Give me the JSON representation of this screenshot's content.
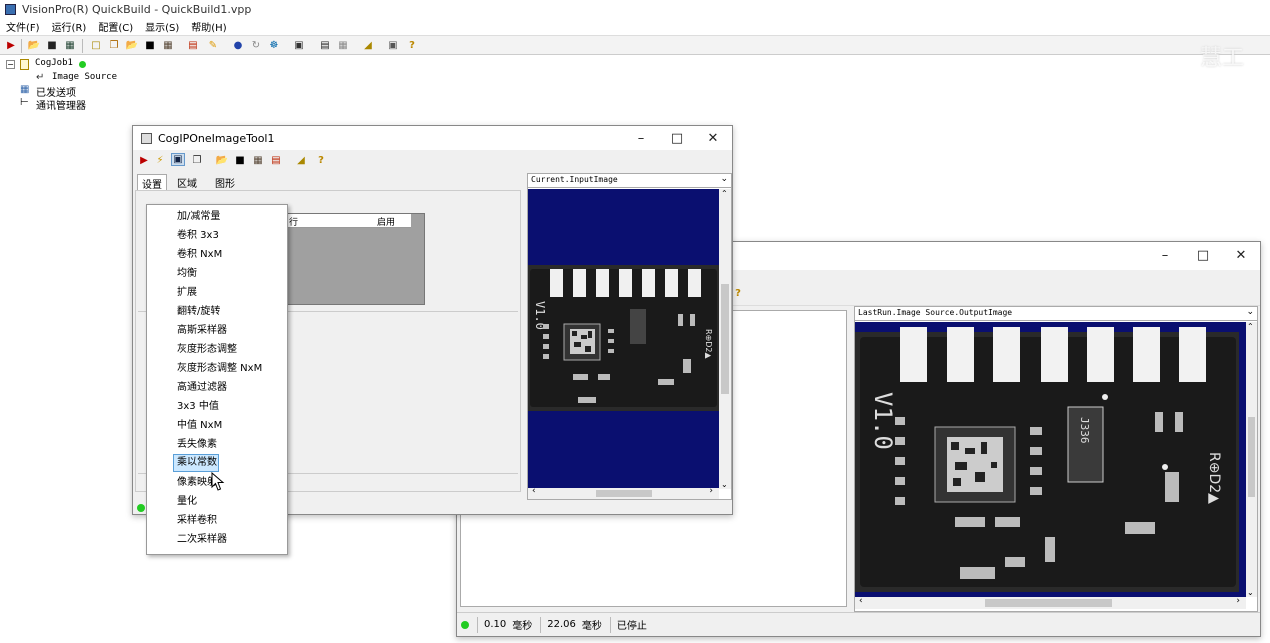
{
  "app": {
    "title": "VisionPro(R) QuickBuild - QuickBuild1.vpp"
  },
  "menubar": [
    {
      "label": "文件(F)"
    },
    {
      "label": "运行(R)"
    },
    {
      "label": "配置(C)"
    },
    {
      "label": "显示(S)"
    },
    {
      "label": "帮助(H)"
    }
  ],
  "tree": {
    "job": "CogJob1",
    "image_source": "Image Source",
    "posted_items": "已发送项",
    "comm_manager": "通讯管理器"
  },
  "tool_window": {
    "title": "CogIPOneImageTool1",
    "tabs": [
      {
        "label": "设置"
      },
      {
        "label": "区域"
      },
      {
        "label": "图形"
      }
    ],
    "list_headers": {
      "col1": "行",
      "col2": "启用"
    },
    "display_selector": "Current.InputImage"
  },
  "context_menu": {
    "items": [
      {
        "label": "加/减常量"
      },
      {
        "label": "卷积 3x3"
      },
      {
        "label": "卷积 NxM"
      },
      {
        "label": "均衡"
      },
      {
        "label": "扩展"
      },
      {
        "label": "翻转/旋转"
      },
      {
        "label": "高斯采样器"
      },
      {
        "label": "灰度形态调整"
      },
      {
        "label": "灰度形态调整 NxM"
      },
      {
        "label": "高通过滤器"
      },
      {
        "label": "3x3 中值"
      },
      {
        "label": "中值 NxM"
      },
      {
        "label": "丢失像素"
      },
      {
        "label": "乘以常数"
      },
      {
        "label": "像素映射"
      },
      {
        "label": "量化"
      },
      {
        "label": "采样卷积"
      },
      {
        "label": "二次采样器"
      }
    ],
    "highlighted": "乘以常数"
  },
  "job_window": {
    "display_selector": "LastRun.Image Source.OutputImage",
    "status": {
      "time1": "0.10",
      "unit1": "毫秒",
      "time2": "22.06",
      "unit2": "毫秒",
      "state": "已停止"
    }
  },
  "pcb": {
    "board_label": "V1.0",
    "part_label": "J336",
    "marking": "R⊕D2▲"
  },
  "watermark": "慧工"
}
